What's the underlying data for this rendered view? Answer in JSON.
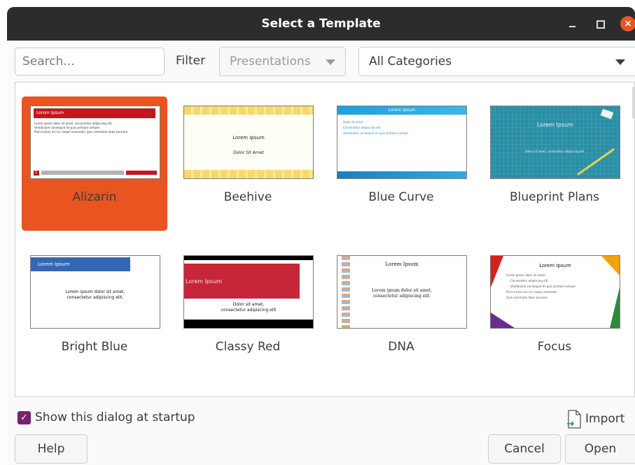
{
  "window": {
    "title": "Select a Template",
    "close_glyph": "×"
  },
  "search": {
    "placeholder": "Search..."
  },
  "filter": {
    "label": "Filter",
    "selected": "Presentations"
  },
  "category": {
    "selected": "All Categories"
  },
  "templates": [
    {
      "label": "Alizarin",
      "selected": true,
      "thumb": {
        "title": "Lorem Ipsum",
        "lines": [
          "Lorem ipsum dolor sit amet, consectetur adipiscing elit.",
          "Vestibulum consequat mi quis pretium semper.",
          "Proin luctus orci ac neque venenatis, quis commodo dolor posuere."
        ],
        "page": "1"
      }
    },
    {
      "label": "Beehive",
      "selected": false,
      "thumb": {
        "title": "Lorem Ipsum",
        "subtitle": "Dolor Sit Amet"
      }
    },
    {
      "label": "Blue Curve",
      "selected": false,
      "thumb": {
        "title": "Lorem Ipsum",
        "bullets": [
          "Dolor sit amet",
          "Consectetur adipiscing elit",
          "Vestibulum consequat mi quis pretium semper"
        ]
      }
    },
    {
      "label": "Blueprint Plans",
      "selected": false,
      "thumb": {
        "title": "Lorem Ipsum",
        "subtitle": "Dolor sit amet, consectetur adipiscing elit."
      }
    },
    {
      "label": "Bright Blue",
      "selected": false,
      "thumb": {
        "title": "Lorem Ipsum",
        "body": "Lorem ipsum dolor sit amet,",
        "body2": "consectetur adipiscing elit."
      }
    },
    {
      "label": "Classy Red",
      "selected": false,
      "thumb": {
        "title": "Lorem Ipsum",
        "body": "Dolor sit amet,",
        "body2": "consectetur adipiscing elit"
      }
    },
    {
      "label": "DNA",
      "selected": false,
      "thumb": {
        "title": "Lorem Ipsum",
        "body": "Lorem ipsum dolor sit amet,",
        "body2": "consectetur adipiscing elit."
      }
    },
    {
      "label": "Focus",
      "selected": false,
      "thumb": {
        "title": "Lorem Ipsum",
        "bullets": [
          "Lorem ipsum dolor sit amet",
          "Consectetur adipiscing elit",
          "Vestibulum consequat mi quis pretium semper",
          "Proin luctus orci ac neque venenatis",
          "Quis commodo dolor posuere"
        ]
      }
    }
  ],
  "startup": {
    "label": "Show this dialog at startup",
    "checked": true,
    "check_glyph": "✓"
  },
  "import": {
    "label": "Import"
  },
  "buttons": {
    "help": "Help",
    "cancel": "Cancel",
    "open": "Open"
  },
  "colors": {
    "accent_selected": "#e95420",
    "checkbox": "#77216f",
    "titlebar": "#2c2c2c"
  }
}
